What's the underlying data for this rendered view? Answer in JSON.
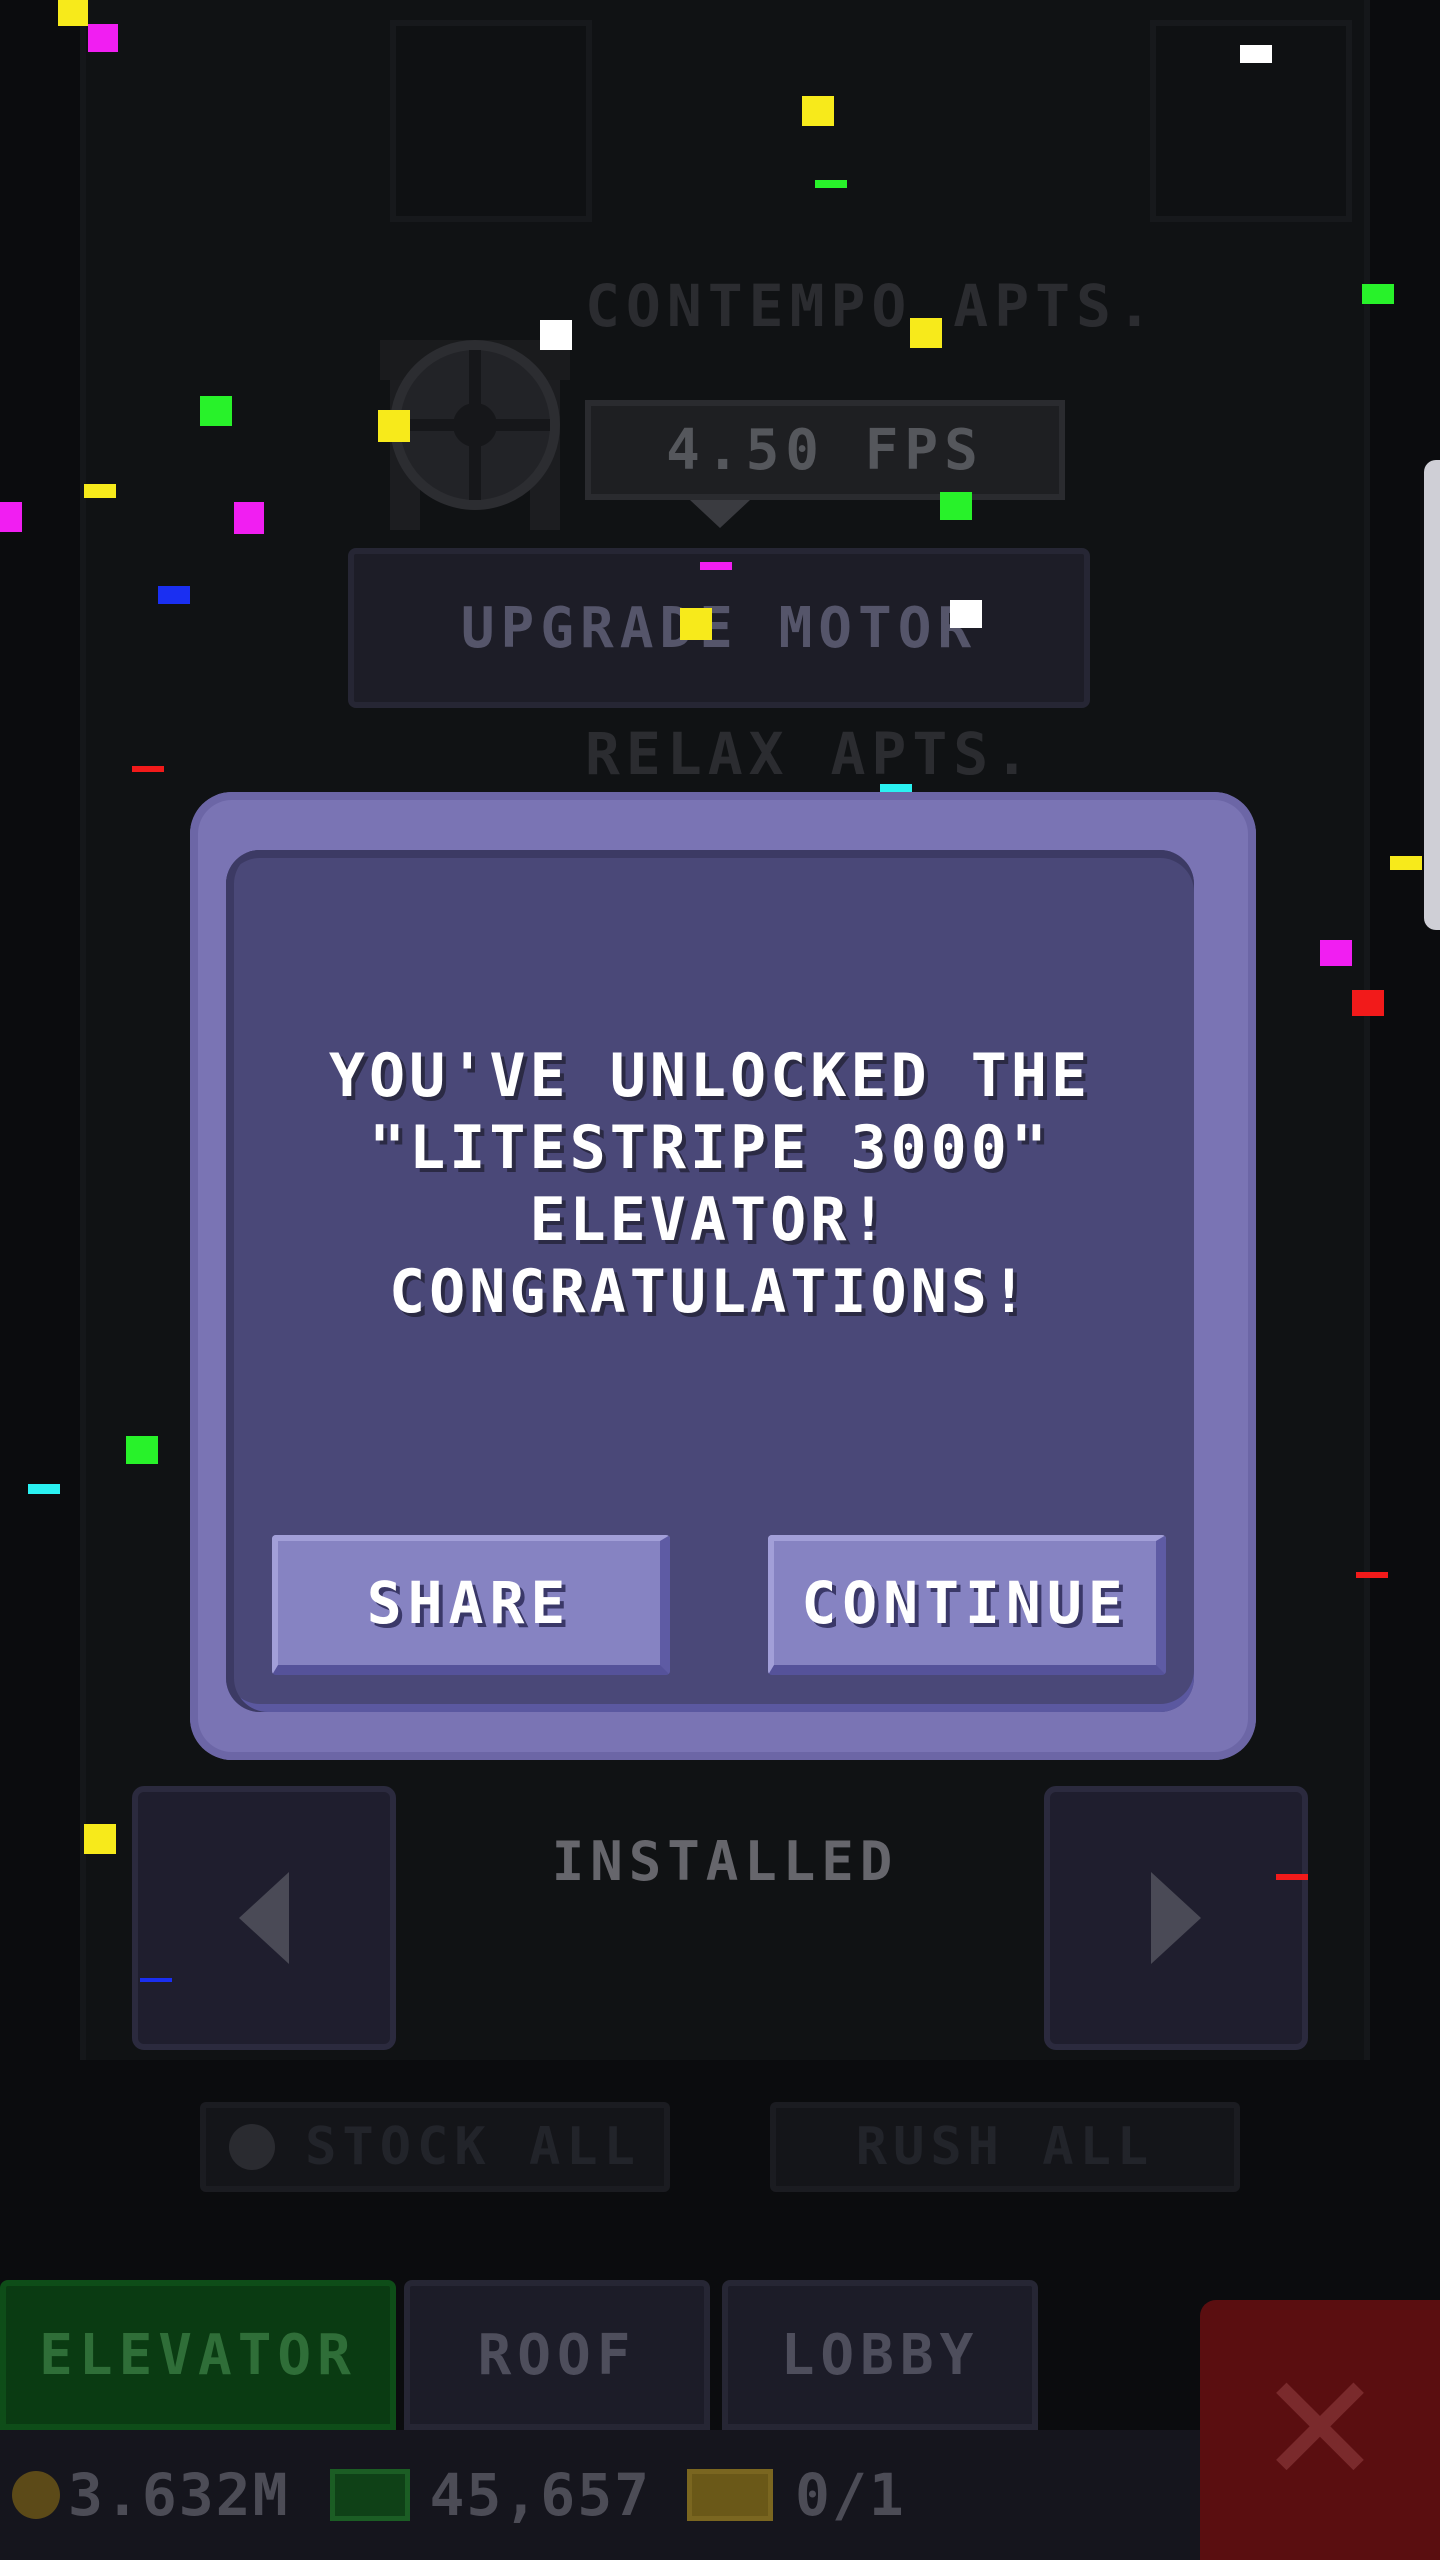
{
  "background": {
    "floor_top_title": "CONTEMPO APTS.",
    "floor_bottom_title": "RELAX APTS.",
    "fps_label": "4.50 FPS",
    "upgrade_button": "UPGRADE MOTOR",
    "installed_label": "INSTALLED",
    "stock_all": "STOCK ALL",
    "rush_all": "RUSH ALL"
  },
  "modal": {
    "message_lines": [
      "YOU'VE UNLOCKED THE",
      "\"LITESTRIPE 3000\"",
      "ELEVATOR!",
      "CONGRATULATIONS!"
    ],
    "share_label": "SHARE",
    "continue_label": "CONTINUE"
  },
  "tabs": {
    "elevator": "ELEVATOR",
    "roof": "ROOF",
    "lobby": "LOBBY"
  },
  "status": {
    "coins": "3.632M",
    "cash": "45,657",
    "tickets": "0/1"
  },
  "colors": {
    "modal_frame": "#7a74b4",
    "modal_panel": "#4a4878",
    "button": "#8683c2",
    "elevator_tab": "#0a3b12",
    "close_button": "#5a0e10"
  },
  "icons": [
    "motor-gear-icon",
    "arrow-left-icon",
    "arrow-right-icon",
    "close-x-icon",
    "coin-icon",
    "cash-icon",
    "ticket-icon",
    "clock-icon"
  ]
}
